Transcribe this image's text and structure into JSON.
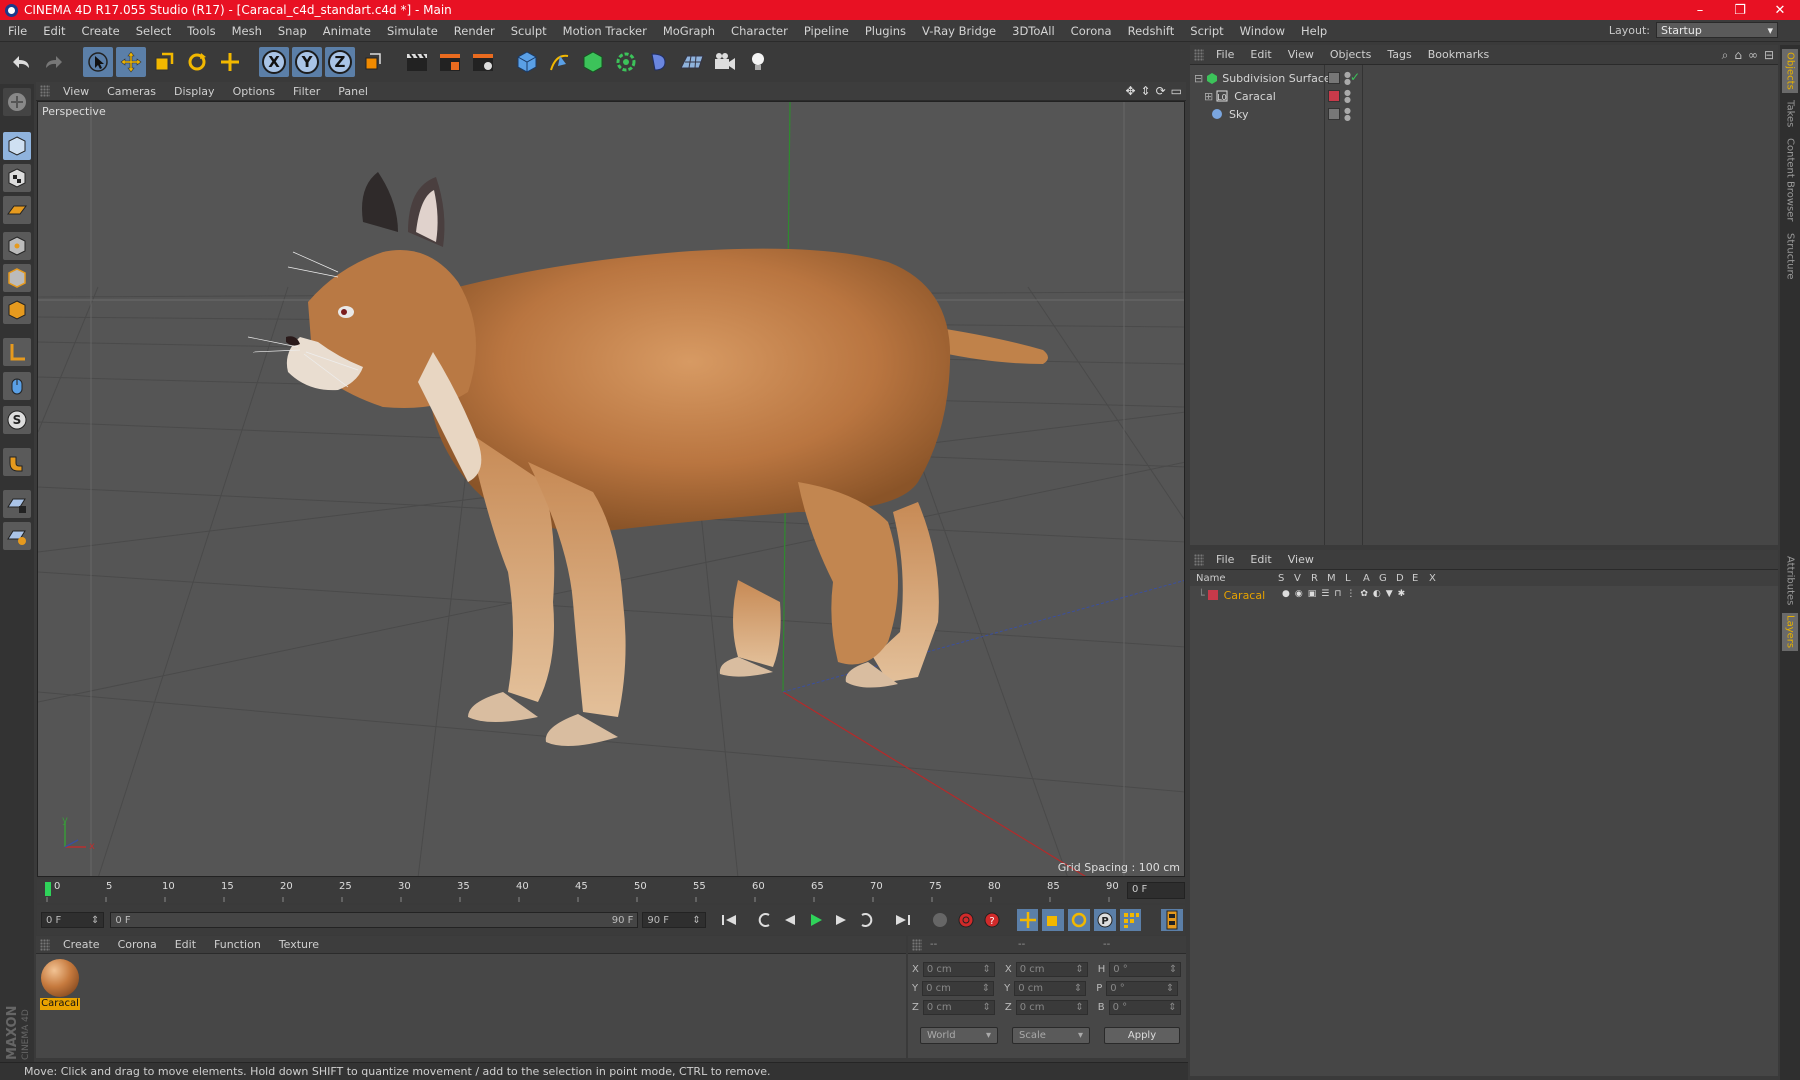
{
  "window": {
    "title": "CINEMA 4D R17.055 Studio (R17) - [Caracal_c4d_standart.c4d *] - Main",
    "minimize": "–",
    "maximize": "❐",
    "close": "✕"
  },
  "menu": [
    "File",
    "Edit",
    "Create",
    "Select",
    "Tools",
    "Mesh",
    "Snap",
    "Animate",
    "Simulate",
    "Render",
    "Sculpt",
    "Motion Tracker",
    "MoGraph",
    "Character",
    "Pipeline",
    "Plugins",
    "V-Ray Bridge",
    "3DToAll",
    "Corona",
    "Redshift",
    "Script",
    "Window",
    "Help"
  ],
  "layout": {
    "label": "Layout:",
    "value": "Startup"
  },
  "toolbar": {
    "axis_x": "X",
    "axis_y": "Y",
    "axis_z": "Z"
  },
  "viewport": {
    "menu": [
      "View",
      "Cameras",
      "Display",
      "Options",
      "Filter",
      "Panel"
    ],
    "camera_label": "Perspective",
    "grid_spacing": "Grid Spacing : 100 cm",
    "axis_y": "y",
    "axis_x": "x"
  },
  "timeline": {
    "ticks": [
      "0",
      "5",
      "10",
      "15",
      "20",
      "25",
      "30",
      "35",
      "40",
      "45",
      "50",
      "55",
      "60",
      "65",
      "70",
      "75",
      "80",
      "85",
      "90"
    ],
    "current_frame": "0 F",
    "start_field": "0 F",
    "range_start": "0 F",
    "range_end": "90 F",
    "end_field": "90 F"
  },
  "material_manager": {
    "menu": [
      "Create",
      "Corona",
      "Edit",
      "Function",
      "Texture"
    ],
    "materials": [
      {
        "name": "Caracal"
      }
    ]
  },
  "coordinates": {
    "header": [
      "--",
      "--",
      "--"
    ],
    "rows": [
      {
        "a": "X",
        "av": "0 cm",
        "b": "X",
        "bv": "0 cm",
        "c": "H",
        "cv": "0 °"
      },
      {
        "a": "Y",
        "av": "0 cm",
        "b": "Y",
        "bv": "0 cm",
        "c": "P",
        "cv": "0 °"
      },
      {
        "a": "Z",
        "av": "0 cm",
        "b": "Z",
        "bv": "0 cm",
        "c": "B",
        "cv": "0 °"
      }
    ],
    "mode": "World",
    "scale": "Scale",
    "apply": "Apply"
  },
  "status": "Move: Click and drag to move elements. Hold down SHIFT to quantize movement / add to the selection in point mode, CTRL to remove.",
  "object_manager": {
    "menu": [
      "File",
      "Edit",
      "View",
      "Objects",
      "Tags",
      "Bookmarks"
    ],
    "objects": [
      {
        "name": "Subdivision Surface",
        "icon": "subdivision-icon"
      },
      {
        "name": "Caracal",
        "icon": "null-object-icon"
      },
      {
        "name": "Sky",
        "icon": "sky-icon"
      }
    ]
  },
  "layer_manager": {
    "menu": [
      "File",
      "Edit",
      "View"
    ],
    "columns": [
      "Name",
      "S",
      "V",
      "R",
      "M",
      "L",
      "A",
      "G",
      "D",
      "E",
      "X"
    ],
    "layers": [
      {
        "name": "Caracal",
        "color": "#c83a4a"
      }
    ]
  },
  "side_tabs": [
    "Objects",
    "Takes",
    "Content Browser",
    "Structure",
    "Attributes",
    "Layers"
  ],
  "brand": "MAXON CINEMA 4D",
  "colors": {
    "title_bar": "#e81123",
    "accent": "#e6a200",
    "selection_blue": "#8fb3dd"
  }
}
